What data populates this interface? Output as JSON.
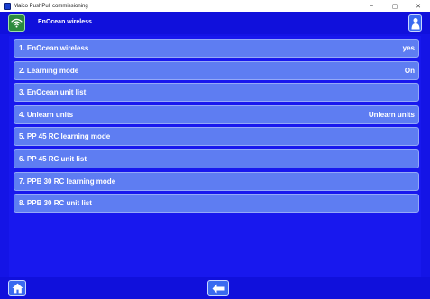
{
  "window": {
    "title": "Maico PushPull commissioning",
    "minimize": "–",
    "maximize": "▢",
    "close": "✕"
  },
  "header": {
    "title": "EnOcean wireless",
    "left_icon": "wifi-icon",
    "right_icon": "user-icon"
  },
  "menu": {
    "items": [
      {
        "label": "1. EnOcean wireless",
        "value": "yes"
      },
      {
        "label": "2. Learning mode",
        "value": "On"
      },
      {
        "label": "3. EnOcean unit list",
        "value": ""
      },
      {
        "label": "4. Unlearn units",
        "value": "Unlearn units"
      },
      {
        "label": "5. PP 45 RC learning mode",
        "value": ""
      },
      {
        "label": "6. PP 45 RC unit list",
        "value": ""
      },
      {
        "label": "7. PPB 30 RC learning mode",
        "value": ""
      },
      {
        "label": "8. PPB 30 RC unit list",
        "value": ""
      }
    ]
  },
  "footer": {
    "home_icon": "home-icon",
    "back_icon": "back-arrow-icon"
  },
  "colors": {
    "background": "#1414e6",
    "item": "#5e7df2",
    "wifi_button": "#2c8a3e"
  }
}
